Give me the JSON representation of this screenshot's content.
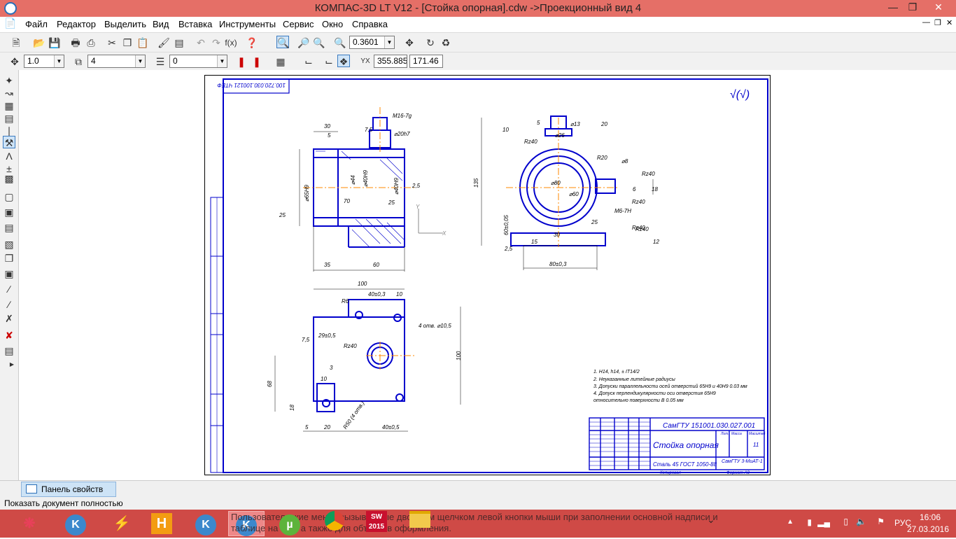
{
  "window": {
    "title": "КОМПАС-3D LT V12 - [Стойка опорная].cdw ->Проекционный вид 4"
  },
  "menu": [
    "Файл",
    "Редактор",
    "Выделить",
    "Вид",
    "Вставка",
    "Инструменты",
    "Сервис",
    "Окно",
    "Справка"
  ],
  "toolbar1": {
    "zoom_value": "0.3601"
  },
  "toolbar2": {
    "line_scale": "1.0",
    "layer_value": "4",
    "style_value": "0",
    "coord_x": "355.885",
    "coord_y": "171.46"
  },
  "drawing": {
    "designation": "СамГТУ 151001.030.027.001",
    "stamp_mirror": "100.720.030.100121 ЧТЕФ",
    "part_name": "Стойка опорная",
    "material": "Сталь 45  ГОСТ 1050-88",
    "org": "СамГТУ 3-МиАТ-1",
    "sheet_count": "11",
    "roughness_corner": "√(√)",
    "notes": [
      "1. H14, h14, ± IT14/2",
      "2. Неуказанные литейные радиусы",
      "3. Допуски параллельности осей отверстий 65H9 и 40H9 0.03 мм",
      "4. Допуск перпендикулярности оси отверстия 65H9",
      "относительно поверхности В 0.05 мм"
    ],
    "dims": {
      "m16": "M16-7g",
      "d20h7": "⌀20h7",
      "d30": "30",
      "d5": "5",
      "d7_5": "7,5",
      "d65h9": "⌀65H9",
      "d44": "⌀44",
      "d40h9": "⌀40H9",
      "d40h9b": "⌀40H9",
      "d70": "70",
      "d25": "25",
      "d2_5": "2,5",
      "ra25": "25",
      "d35": "35",
      "d60": "60",
      "d13": "⌀13",
      "d26": "⌀26",
      "d5b": "5",
      "d10": "10",
      "rz40a": "Rz40",
      "d20": "20",
      "r20": "R20",
      "d8": "⌀8",
      "rz40b": "Rz40",
      "d135": "135",
      "d80": "⌀80",
      "d60b": "⌀60",
      "rz40c": "Rz40",
      "d6": "6",
      "d18": "18",
      "rz40d": "Rz40",
      "m6": "M6-7H",
      "d25b": "25",
      "rz40e": "Rz40",
      "d60_05": "60±0,05",
      "d30b": "30",
      "d15": "15",
      "d12": "12",
      "d2_5b": "2,5",
      "d80_03": "80±0,3",
      "d100": "100",
      "d40_03": "40±0,3",
      "d10b": "10",
      "r6": "R6",
      "holes": "4 отв. ⌀10,5",
      "d7_5b": "7,5",
      "d29": "29±0,5",
      "rz40f": "Rz40",
      "d3": "3",
      "d10c": "10",
      "d68": "68",
      "d100b": "100",
      "d18b": "18",
      "d5c": "5",
      "d20b": "20",
      "d40_05": "40±0,5",
      "r50": "R50 (4 отв.)"
    },
    "title_block": {
      "lit": "Лит.",
      "mass": "Масса",
      "scale": "Масштаб",
      "sheet": "Лист",
      "sheets": "Листов",
      "copied": "Копировал",
      "format": "Формат А3"
    }
  },
  "panel": {
    "properties_tab": "Панель свойств"
  },
  "status": "Показать документ полностью",
  "taskbar": {
    "hint": "Пользовательские меню, вызываемые двойным щелчком левой кнопки мыши при заполнении основной надписи и таблице на ней, а также для объектов оформления.",
    "lang": "РУС",
    "time": "16:06",
    "date": "27.03.2016",
    "apps": [
      "kompas-graph",
      "winamp-app",
      "h-app",
      "kompas-1",
      "kompas-2",
      "utorrent",
      "chrome",
      "solidworks-2015",
      "explorer"
    ],
    "sw_label": "2015"
  },
  "colors": {
    "titlebar": "#e56f67",
    "taskbar": "#cf4a46",
    "drawing_blue": "#0000cc",
    "axis_orange": "#ff8800"
  }
}
